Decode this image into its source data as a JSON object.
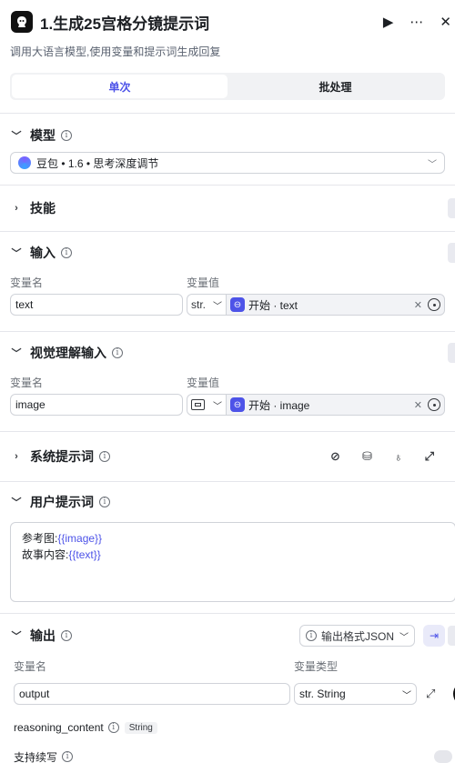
{
  "header": {
    "title": "1.生成25宫格分镜提示词",
    "description": "调用大语言模型,使用变量和提示词生成回复"
  },
  "tabs": [
    {
      "label": "单次",
      "active": true
    },
    {
      "label": "批处理",
      "active": false
    }
  ],
  "model": {
    "label": "模型",
    "selected": "豆包 • 1.6 • 思考深度调节"
  },
  "skills": {
    "label": "技能"
  },
  "input": {
    "label": "输入",
    "col_name": "变量名",
    "col_value": "变量值",
    "var_name": "text",
    "type": "str.",
    "ref": "开始 · text"
  },
  "visual_input": {
    "label": "视觉理解输入",
    "col_name": "变量名",
    "col_value": "变量值",
    "var_name": "image",
    "type_icon": "image-icon",
    "ref": "开始 · image"
  },
  "system_prompt": {
    "label": "系统提示词"
  },
  "user_prompt": {
    "label": "用户提示词",
    "line1_label": "参考图:",
    "line1_var": "{{image}}",
    "line2_label": "故事内容:",
    "line2_var": "{{text}}"
  },
  "output": {
    "label": "输出",
    "format_button": "输出格式JSON",
    "col_name": "变量名",
    "col_type": "变量类型",
    "var_name": "output",
    "var_type": "str. String",
    "reasoning_label": "reasoning_content",
    "reasoning_type": "String",
    "continue_label": "支持续写"
  },
  "colors": {
    "accent": "#4d53e8",
    "border": "#d0d3d9"
  }
}
